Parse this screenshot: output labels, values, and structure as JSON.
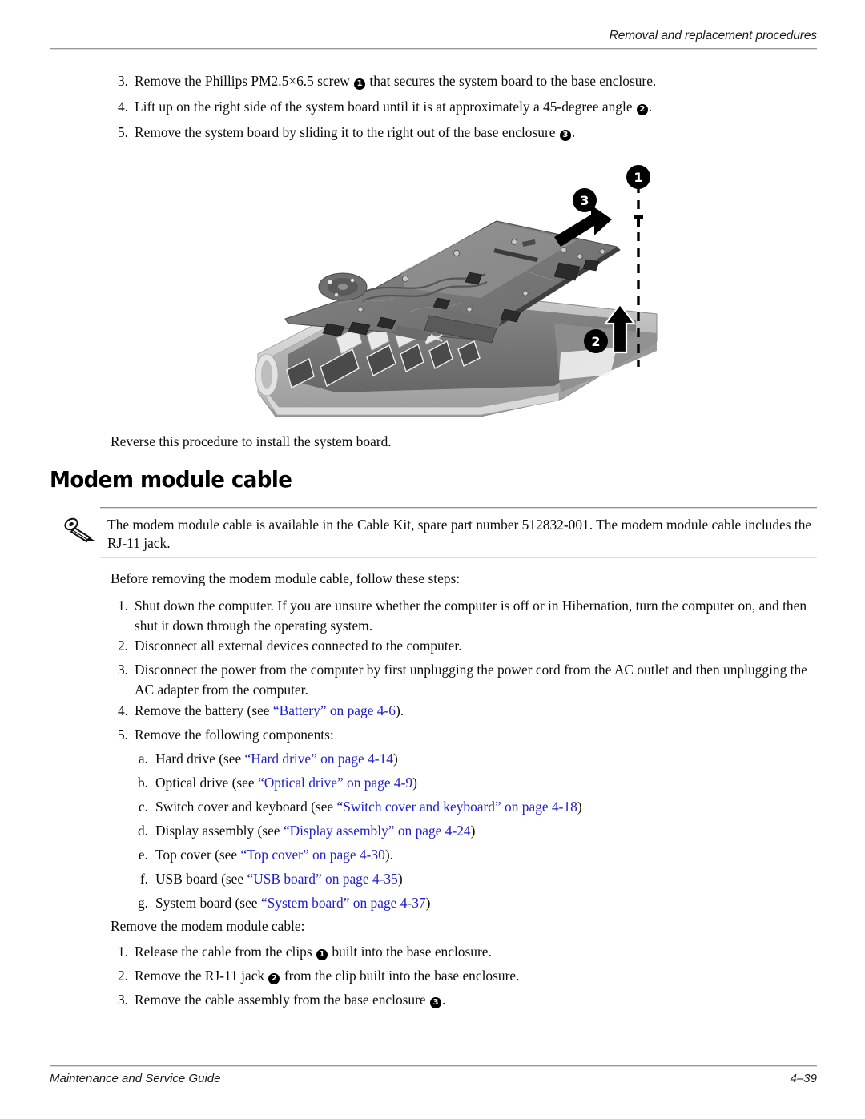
{
  "header": {
    "title": "Removal and replacement procedures"
  },
  "footer": {
    "guide": "Maintenance and Service Guide",
    "page_number": "4–39"
  },
  "colors": {
    "link": "#2020c8",
    "rule": "#9a9a9a",
    "text": "#0d0d0d"
  },
  "top_steps": [
    {
      "marker": "3.",
      "pre": "Remove the Phillips PM2.5×6.5 screw ",
      "callout": "1",
      "post": " that secures the system board to the base enclosure."
    },
    {
      "marker": "4.",
      "pre": "Lift up on the right side of the system board until it is at approximately a 45-degree angle ",
      "callout": "2",
      "post": "."
    },
    {
      "marker": "5.",
      "pre": "Remove the system board by sliding it to the right out of the base enclosure ",
      "callout": "3",
      "post": "."
    }
  ],
  "figure": {
    "alt": "Exploded view of the system board being lifted and slid out of the notebook base enclosure",
    "callouts": [
      {
        "label": "1",
        "meaning": "screw location"
      },
      {
        "label": "2",
        "meaning": "lift right side to 45 degrees"
      },
      {
        "label": "3",
        "meaning": "slide board to the right"
      }
    ]
  },
  "reverse_note": "Reverse this procedure to install the system board.",
  "section": {
    "heading": "Modem module cable"
  },
  "note": {
    "icon": "pencil-note-icon",
    "line1": "The modem module cable is available in the Cable Kit, spare part number 512832-001. The modem module",
    "line2": "cable includes the RJ-11 jack."
  },
  "before_intro": "Before removing the modem module cable, follow these steps:",
  "before_steps": [
    {
      "marker": "1.",
      "text": "Shut down the computer. If you are unsure whether the computer is off or in Hibernation, turn the computer on, and then shut it down through the operating system."
    },
    {
      "marker": "2.",
      "text": "Disconnect all external devices connected to the computer."
    },
    {
      "marker": "3.",
      "text": "Disconnect the power from the computer by first unplugging the power cord from the AC outlet and then unplugging the AC adapter from the computer."
    },
    {
      "marker": "4.",
      "pre": "Remove the battery (see ",
      "link": "“Battery” on page 4-6",
      "post": ")."
    },
    {
      "marker": "5.",
      "text": "Remove the following components:"
    }
  ],
  "components": [
    {
      "marker": "a.",
      "pre": "Hard drive (see ",
      "link": "“Hard drive” on page 4-14",
      "post": ")"
    },
    {
      "marker": "b.",
      "pre": "Optical drive (see ",
      "link": "“Optical drive” on page 4-9",
      "post": ")"
    },
    {
      "marker": "c.",
      "pre": "Switch cover and keyboard (see ",
      "link": "“Switch cover and keyboard” on page 4-18",
      "post": ")"
    },
    {
      "marker": "d.",
      "pre": "Display assembly (see ",
      "link": "“Display assembly” on page 4-24",
      "post": ")"
    },
    {
      "marker": "e.",
      "pre": "Top cover (see ",
      "link": "“Top cover” on page 4-30",
      "post": ")."
    },
    {
      "marker": "f.",
      "pre": "USB board (see ",
      "link": "“USB board” on page 4-35",
      "post": ")"
    },
    {
      "marker": "g.",
      "pre": "System board (see ",
      "link": "“System board” on page 4-37",
      "post": ")"
    }
  ],
  "remove_intro": "Remove the modem module cable:",
  "remove_steps": [
    {
      "marker": "1.",
      "pre": "Release the cable from the clips ",
      "callout": "1",
      "post": " built into the base enclosure."
    },
    {
      "marker": "2.",
      "pre": "Remove the RJ-11 jack ",
      "callout": "2",
      "post": " from the clip built into the base enclosure."
    },
    {
      "marker": "3.",
      "pre": "Remove the cable assembly from the base enclosure ",
      "callout": "3",
      "post": "."
    }
  ]
}
